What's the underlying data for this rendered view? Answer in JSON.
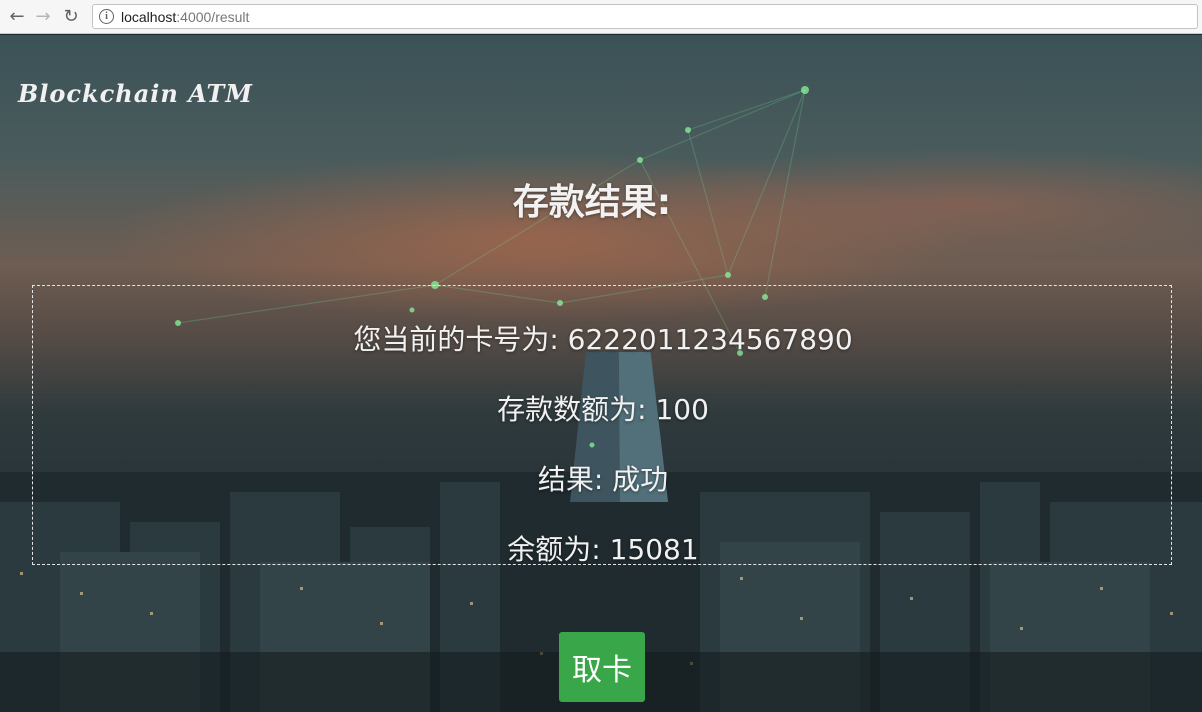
{
  "browser": {
    "url_host": "localhost",
    "url_path": ":4000/result"
  },
  "brand": {
    "title": "Blockchain ATM"
  },
  "result": {
    "title": "存款结果:",
    "card_line": "您当前的卡号为: 6222011234567890",
    "amount_line": "存款数额为: 100",
    "status_line": "结果: 成功",
    "balance_line": "余额为: 15081"
  },
  "actions": {
    "eject_label": "取卡"
  },
  "colors": {
    "accent_button": "#3aa64a",
    "text": "#f1f1f1"
  }
}
